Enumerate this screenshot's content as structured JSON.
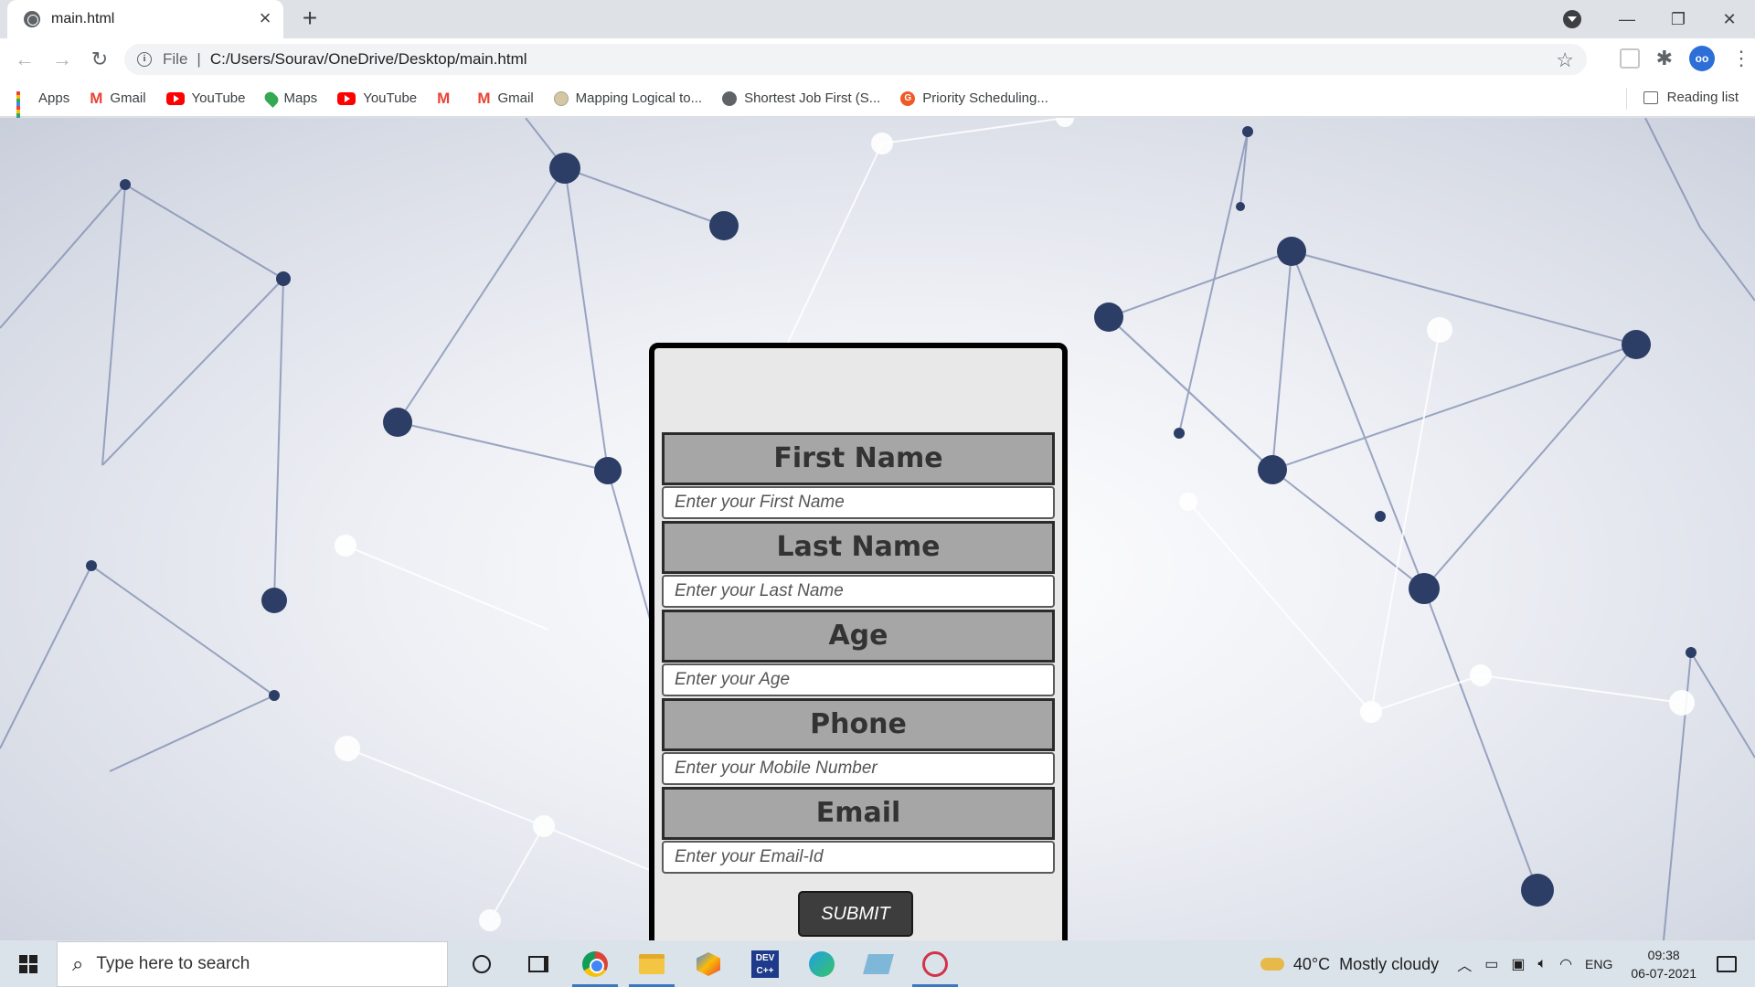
{
  "browser": {
    "tab_title": "main.html",
    "tab_close": "×",
    "new_tab": "+",
    "window_controls": [
      "—",
      "❐",
      "✕"
    ],
    "address_scheme": "File",
    "address_url": "C:/Users/Sourav/OneDrive/Desktop/main.html",
    "bookmarks": [
      {
        "label": "Apps",
        "icon": "apps-grid-icon"
      },
      {
        "label": "Gmail",
        "icon": "gmail-icon"
      },
      {
        "label": "YouTube",
        "icon": "youtube-icon"
      },
      {
        "label": "Maps",
        "icon": "maps-icon"
      },
      {
        "label": "YouTube",
        "icon": "youtube-icon"
      },
      {
        "label": "",
        "icon": "gmail-icon"
      },
      {
        "label": "Gmail",
        "icon": "gmail-icon"
      },
      {
        "label": "Mapping Logical to...",
        "icon": "map-site-icon"
      },
      {
        "label": "Shortest Job First (S...",
        "icon": "globe-icon"
      },
      {
        "label": "Priority Scheduling...",
        "icon": "g-site-icon"
      }
    ],
    "reading_list": "Reading list"
  },
  "form": {
    "fields": [
      {
        "label": "First Name",
        "placeholder": "Enter your First Name"
      },
      {
        "label": "Last Name",
        "placeholder": "Enter your Last Name"
      },
      {
        "label": "Age",
        "placeholder": "Enter your Age"
      },
      {
        "label": "Phone",
        "placeholder": "Enter your Mobile Number"
      },
      {
        "label": "Email",
        "placeholder": "Enter your Email-Id"
      }
    ],
    "submit_label": "SUBMIT"
  },
  "taskbar": {
    "search_placeholder": "Type here to search",
    "weather_temp": "40°C",
    "weather_desc": "Mostly cloudy",
    "language": "ENG",
    "time": "09:38",
    "date": "06-07-2021"
  },
  "colors": {
    "form_label_bg": "#a6a6a6",
    "form_card_bg": "#e8e8e8",
    "submit_bg": "#3d3d3d",
    "taskbar_bg": "#dbe3ea"
  }
}
